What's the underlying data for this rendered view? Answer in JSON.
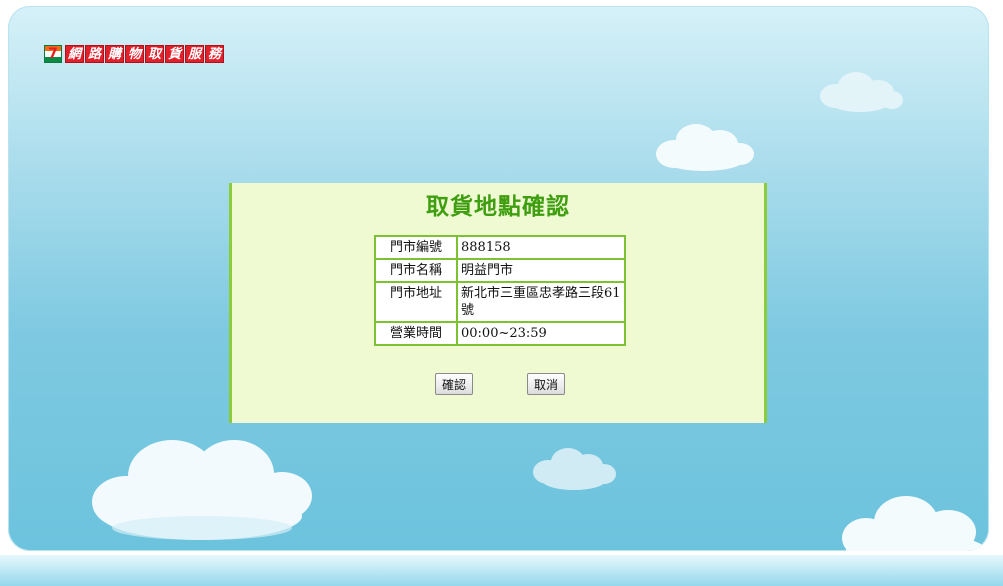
{
  "logo": {
    "mark": "7",
    "chars": [
      "網",
      "路",
      "購",
      "物",
      "取",
      "貨",
      "服",
      "務"
    ]
  },
  "dialog": {
    "title": "取貨地點確認",
    "rows": [
      {
        "label": "門市編號",
        "value": "888158"
      },
      {
        "label": "門市名稱",
        "value": "明益門市"
      },
      {
        "label": "門市地址",
        "value": "新北市三重區忠孝路三段61號"
      },
      {
        "label": "營業時間",
        "value": "00:00~23:59"
      }
    ],
    "confirm_label": "確認",
    "cancel_label": "取消"
  },
  "colors": {
    "title_green": "#3f9e10",
    "table_border": "#7cc232",
    "dialog_bg": "#effad2",
    "logo_red": "#e0202a",
    "sky_top": "#d6f1f8",
    "sky_bottom": "#6cc3dd"
  }
}
